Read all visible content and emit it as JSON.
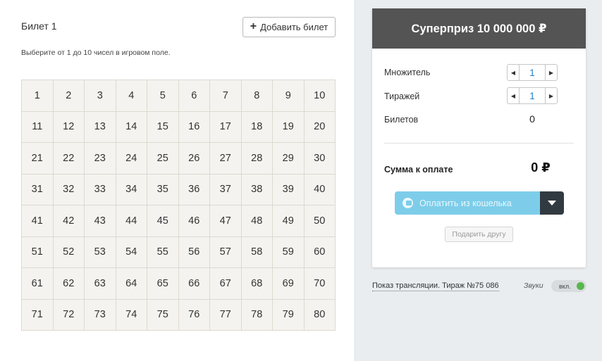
{
  "ticket": {
    "title": "Билет 1",
    "add_button_label": "Добавить билет",
    "add_icon": "plus-icon",
    "hint": "Выберите от 1 до 10 чисел в игровом поле.",
    "numbers": [
      "1",
      "2",
      "3",
      "4",
      "5",
      "6",
      "7",
      "8",
      "9",
      "10",
      "11",
      "12",
      "13",
      "14",
      "15",
      "16",
      "17",
      "18",
      "19",
      "20",
      "21",
      "22",
      "23",
      "24",
      "25",
      "26",
      "27",
      "28",
      "29",
      "30",
      "31",
      "32",
      "33",
      "34",
      "35",
      "36",
      "37",
      "38",
      "39",
      "40",
      "41",
      "42",
      "43",
      "44",
      "45",
      "46",
      "47",
      "48",
      "49",
      "50",
      "51",
      "52",
      "53",
      "54",
      "55",
      "56",
      "57",
      "58",
      "59",
      "60",
      "61",
      "62",
      "63",
      "64",
      "65",
      "66",
      "67",
      "68",
      "69",
      "70",
      "71",
      "72",
      "73",
      "74",
      "75",
      "76",
      "77",
      "78",
      "79",
      "80"
    ]
  },
  "panel": {
    "superprize": "Суперприз 10 000 000 ₽",
    "multiplier_label": "Множитель",
    "multiplier_value": "1",
    "draws_label": "Тиражей",
    "draws_value": "1",
    "tickets_label": "Билетов",
    "tickets_value": "0",
    "sum_label": "Сумма к оплате",
    "sum_value": "0 ₽",
    "pay_button_label": "Оплатить из кошелька",
    "gift_button_label": "Подарить другу"
  },
  "footer": {
    "broadcast_link": "Показ трансляции. Тираж №75 086",
    "sounds_label": "Звуки",
    "sounds_toggle_label": "вкл."
  },
  "colors": {
    "header_bg": "#545454",
    "pay_button": "#7dcdea",
    "dropdown_button": "#323a41",
    "grid_bg": "#f5f3ef",
    "toggle_on": "#57b84c",
    "stepper_value": "#1f7fc4"
  }
}
